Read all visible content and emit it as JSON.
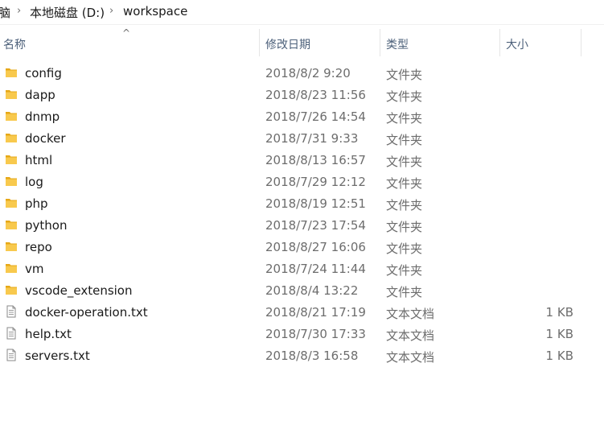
{
  "breadcrumb": {
    "root_fragment": "脑",
    "drive": "本地磁盘 (D:)",
    "folder": "workspace",
    "separator": "›"
  },
  "columns": {
    "name": "名称",
    "date": "修改日期",
    "type": "类型",
    "size": "大小",
    "sort_indicator": "^"
  },
  "colors": {
    "folder_yellow": "#f8c94d",
    "folder_dark": "#e6a817",
    "header_text": "#4c607a",
    "meta_text": "#6d6d6d"
  },
  "files": [
    {
      "icon": "folder-icon",
      "name": "config",
      "date": "2018/8/2 9:20",
      "type": "文件夹",
      "size": ""
    },
    {
      "icon": "folder-icon",
      "name": "dapp",
      "date": "2018/8/23 11:56",
      "type": "文件夹",
      "size": ""
    },
    {
      "icon": "folder-icon",
      "name": "dnmp",
      "date": "2018/7/26 14:54",
      "type": "文件夹",
      "size": ""
    },
    {
      "icon": "folder-icon",
      "name": "docker",
      "date": "2018/7/31 9:33",
      "type": "文件夹",
      "size": ""
    },
    {
      "icon": "folder-icon",
      "name": "html",
      "date": "2018/8/13 16:57",
      "type": "文件夹",
      "size": ""
    },
    {
      "icon": "folder-icon",
      "name": "log",
      "date": "2018/7/29 12:12",
      "type": "文件夹",
      "size": ""
    },
    {
      "icon": "folder-icon",
      "name": "php",
      "date": "2018/8/19 12:51",
      "type": "文件夹",
      "size": ""
    },
    {
      "icon": "folder-icon",
      "name": "python",
      "date": "2018/7/23 17:54",
      "type": "文件夹",
      "size": ""
    },
    {
      "icon": "folder-icon",
      "name": "repo",
      "date": "2018/8/27 16:06",
      "type": "文件夹",
      "size": ""
    },
    {
      "icon": "folder-icon",
      "name": "vm",
      "date": "2018/7/24 11:44",
      "type": "文件夹",
      "size": ""
    },
    {
      "icon": "folder-icon",
      "name": "vscode_extension",
      "date": "2018/8/4 13:22",
      "type": "文件夹",
      "size": ""
    },
    {
      "icon": "text-file-icon",
      "name": "docker-operation.txt",
      "date": "2018/8/21 17:19",
      "type": "文本文档",
      "size": "1 KB"
    },
    {
      "icon": "text-file-icon",
      "name": "help.txt",
      "date": "2018/7/30 17:33",
      "type": "文本文档",
      "size": "1 KB"
    },
    {
      "icon": "text-file-icon",
      "name": "servers.txt",
      "date": "2018/8/3 16:58",
      "type": "文本文档",
      "size": "1 KB"
    }
  ]
}
